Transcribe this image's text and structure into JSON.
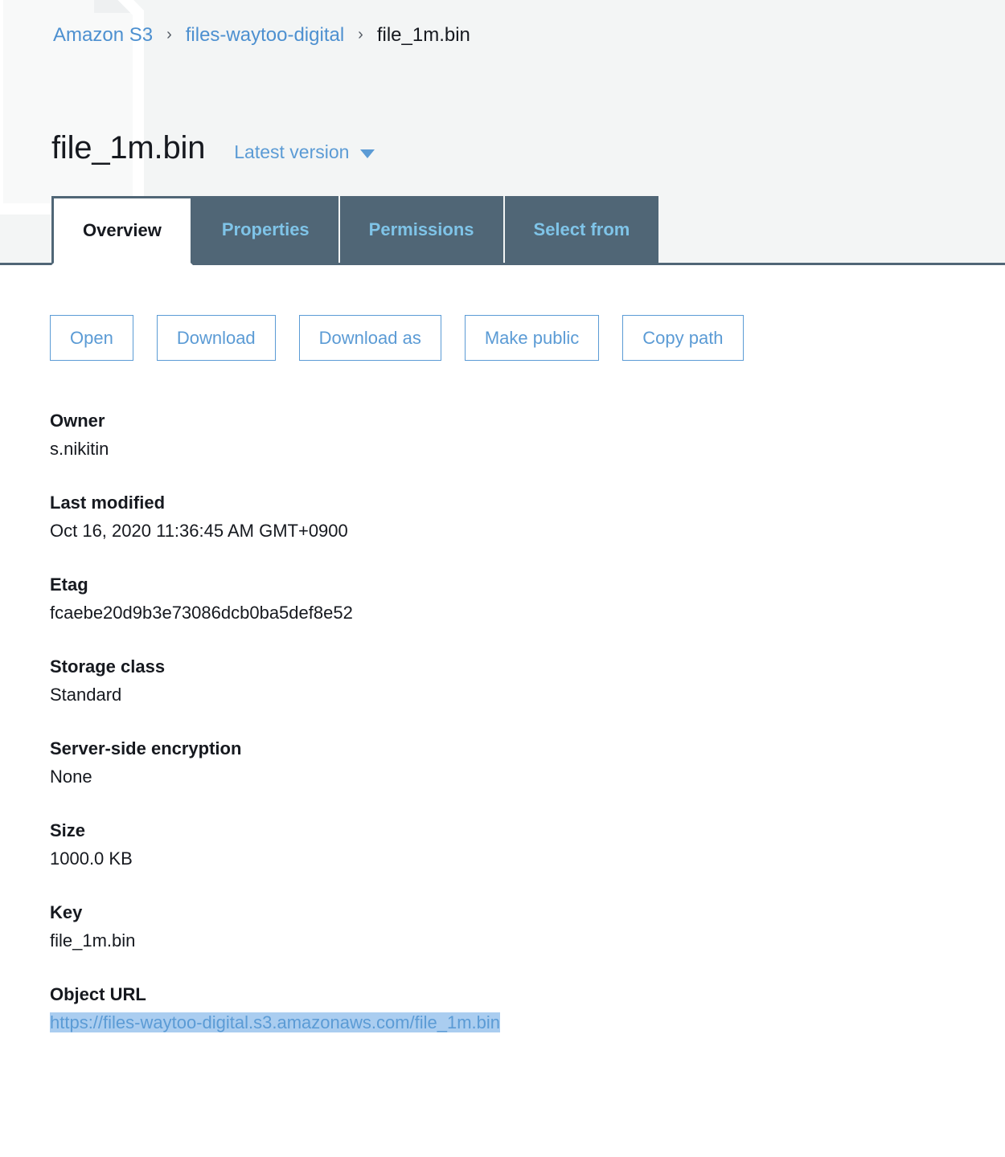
{
  "breadcrumb": {
    "items": [
      {
        "label": "Amazon S3",
        "type": "link"
      },
      {
        "label": "files-waytoo-digital",
        "type": "link"
      },
      {
        "label": "file_1m.bin",
        "type": "current"
      }
    ],
    "separator": "›"
  },
  "header": {
    "title": "file_1m.bin",
    "version_selector": "Latest version"
  },
  "tabs": [
    {
      "label": "Overview",
      "active": true
    },
    {
      "label": "Properties",
      "active": false
    },
    {
      "label": "Permissions",
      "active": false
    },
    {
      "label": "Select from",
      "active": false
    }
  ],
  "actions": [
    {
      "label": "Open"
    },
    {
      "label": "Download"
    },
    {
      "label": "Download as"
    },
    {
      "label": "Make public"
    },
    {
      "label": "Copy path"
    }
  ],
  "metadata": [
    {
      "label": "Owner",
      "value": "s.nikitin"
    },
    {
      "label": "Last modified",
      "value": "Oct 16, 2020 11:36:45 AM GMT+0900"
    },
    {
      "label": "Etag",
      "value": "fcaebe20d9b3e73086dcb0ba5def8e52"
    },
    {
      "label": "Storage class",
      "value": "Standard"
    },
    {
      "label": "Server-side encryption",
      "value": "None"
    },
    {
      "label": "Size",
      "value": "1000.0 KB"
    },
    {
      "label": "Key",
      "value": "file_1m.bin"
    },
    {
      "label": "Object URL",
      "value": "https://files-waytoo-digital.s3.amazonaws.com/file_1m.bin",
      "is_link": true,
      "selected": true
    }
  ],
  "colors": {
    "link_blue": "#4d90d0",
    "button_blue": "#5b9bd5",
    "tab_inactive_bg": "#506676",
    "tab_inactive_text": "#7fc4e8",
    "header_band_bg": "#f3f5f5",
    "text_dark": "#16191f",
    "selection_highlight": "#aacdf0"
  }
}
